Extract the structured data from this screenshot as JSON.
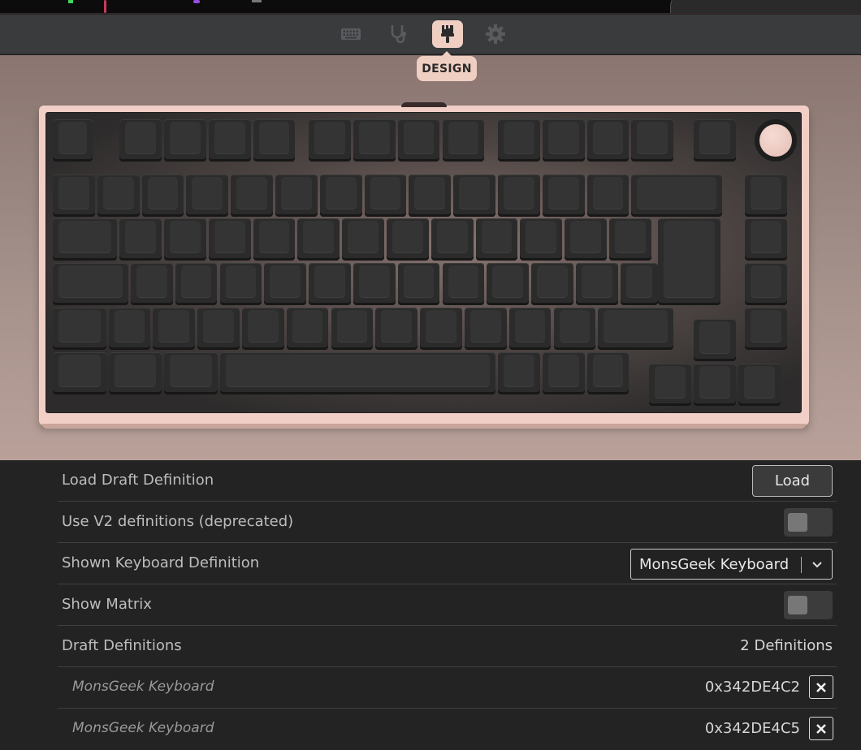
{
  "nav": {
    "tabs": [
      {
        "name": "tab-configure",
        "icon": "keyboard-icon"
      },
      {
        "name": "tab-test",
        "icon": "stethoscope-icon"
      },
      {
        "name": "tab-design",
        "icon": "paintbrush-icon",
        "active": true
      },
      {
        "name": "tab-settings",
        "icon": "gear-icon"
      }
    ],
    "tooltip": "DESIGN"
  },
  "colors": {
    "accent": "#f0cfc3",
    "background": "#232323",
    "navbar": "#3a3b3d",
    "case": "#f2cfc6",
    "keycap": "#343434"
  },
  "settings": {
    "load_draft": {
      "label": "Load Draft Definition",
      "button": "Load"
    },
    "use_v2": {
      "label": "Use V2 definitions (deprecated)",
      "enabled": false
    },
    "shown_definition": {
      "label": "Shown Keyboard Definition",
      "selected": "MonsGeek Keyboard"
    },
    "show_matrix": {
      "label": "Show Matrix",
      "enabled": false
    },
    "draft_definitions": {
      "label": "Draft Definitions",
      "count": "2 Definitions"
    },
    "definitions": [
      {
        "name": "MonsGeek Keyboard",
        "id": "0x342DE4C2"
      },
      {
        "name": "MonsGeek Keyboard",
        "id": "0x342DE4C5"
      }
    ]
  }
}
